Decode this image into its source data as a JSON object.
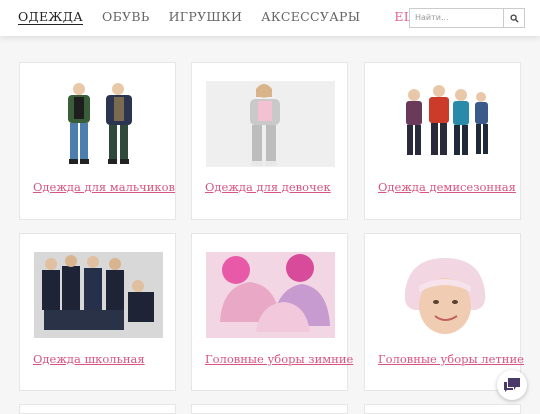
{
  "nav": {
    "items": [
      {
        "label": "ОДЕЖДА",
        "active": true
      },
      {
        "label": "ОБУВЬ",
        "active": false
      },
      {
        "label": "ИГРУШКИ",
        "active": false
      },
      {
        "label": "АКСЕССУАРЫ",
        "active": false
      }
    ],
    "more_label": "ЕЩЁ..."
  },
  "search": {
    "placeholder": "Найти..."
  },
  "categories": [
    {
      "label": "Одежда для мальчиков",
      "icon": "boys-clothes-photo"
    },
    {
      "label": "Одежда для девочек",
      "icon": "girls-clothes-photo"
    },
    {
      "label": "Одежда демисезонная",
      "icon": "demiseason-clothes-photo"
    },
    {
      "label": "Одежда школьная",
      "icon": "school-uniform-photo"
    },
    {
      "label": "Головные уборы зимние",
      "icon": "winter-hats-photo"
    },
    {
      "label": "Головные уборы летние",
      "icon": "summer-hats-photo"
    }
  ],
  "colors": {
    "accent": "#d8557f",
    "more": "#e0608a",
    "chat": "#4a3a6a"
  }
}
